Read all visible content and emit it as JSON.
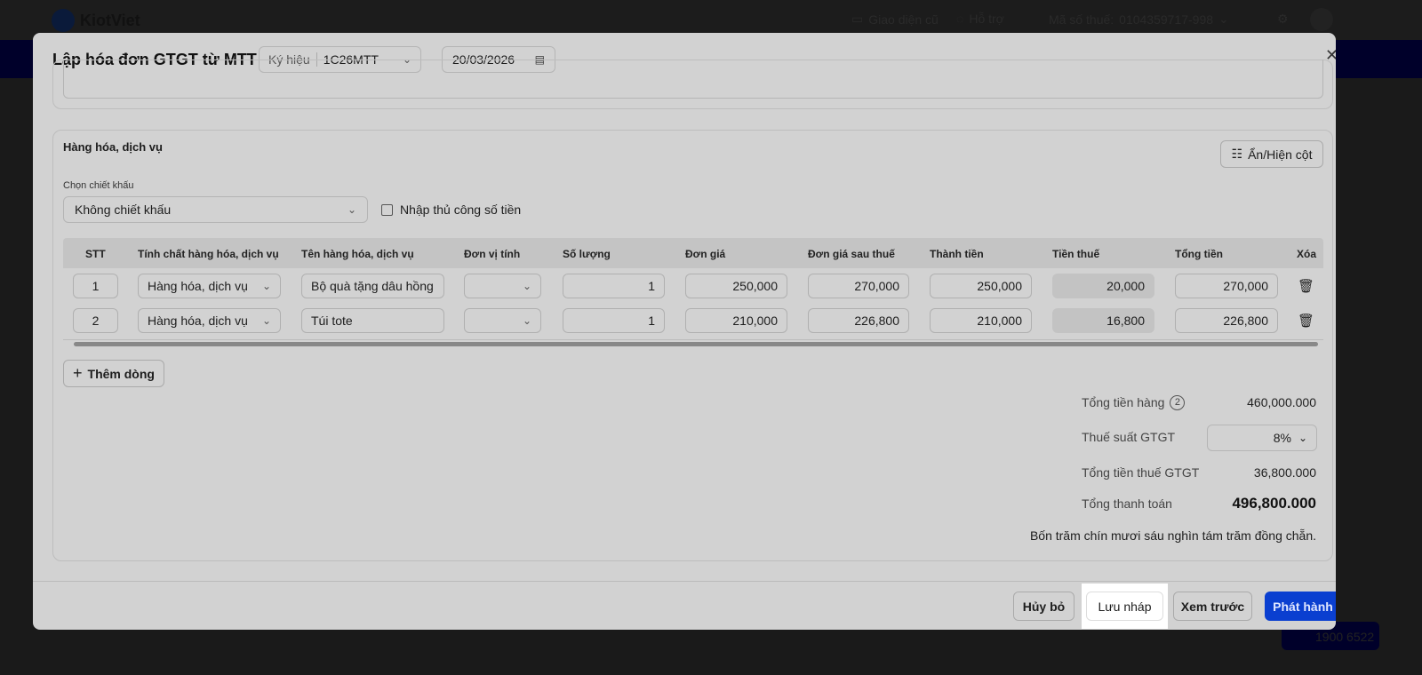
{
  "app": {
    "logo": "KiotViet",
    "old_ui": "Giao diện cũ",
    "support": "Hỗ trợ",
    "tax_label": "Mã số thuế:",
    "tax_code": "0104359717-998",
    "hotline": "1900 6522"
  },
  "modal": {
    "title": "Lập hóa đơn GTGT từ MTT",
    "symbol_label": "Ký hiệu",
    "symbol_value": "1C26MTT",
    "date": "20/03/2026"
  },
  "goods": {
    "title": "Hàng hóa, dịch vụ",
    "toggle_columns": "Ẩn/Hiện cột",
    "discount_label": "Chọn chiết khấu",
    "discount_value": "Không chiết khấu",
    "manual_amount": "Nhập thủ công số tiền",
    "add_row": "Thêm dòng",
    "headers": [
      "STT",
      "Tính chất hàng hóa, dịch vụ",
      "Tên hàng hóa, dịch vụ",
      "Đơn vị tính",
      "Số lượng",
      "Đơn giá",
      "Đơn giá sau thuế",
      "Thành tiền",
      "Tiền thuế",
      "Tổng tiền",
      "Xóa"
    ],
    "rows": [
      {
        "stt": "1",
        "type": "Hàng hóa, dịch vụ",
        "name": "Bộ quà tặng dâu hồng",
        "unit": "",
        "qty": "1",
        "price": "250,000",
        "price_after_tax": "270,000",
        "amount": "250,000",
        "tax": "20,000",
        "total": "270,000"
      },
      {
        "stt": "2",
        "type": "Hàng hóa, dịch vụ",
        "name": "Túi tote",
        "unit": "",
        "qty": "1",
        "price": "210,000",
        "price_after_tax": "226,800",
        "amount": "210,000",
        "tax": "16,800",
        "total": "226,800"
      }
    ]
  },
  "summary": {
    "goods_total_label": "Tổng tiền hàng",
    "goods_count": "2",
    "goods_total": "460,000.000",
    "vat_rate_label": "Thuế suất GTGT",
    "vat_rate": "8%",
    "vat_total_label": "Tổng tiền thuế GTGT",
    "vat_total": "36,800.000",
    "grand_total_label": "Tổng thanh toán",
    "grand_total": "496,800.000",
    "in_words": "Bốn trăm chín mươi sáu nghìn tám trăm đồng chẵn."
  },
  "footer": {
    "cancel": "Hủy bỏ",
    "save_draft": "Lưu nháp",
    "preview": "Xem trước",
    "issue": "Phát hành"
  },
  "colors": {
    "primary": "#0a3fd0"
  }
}
